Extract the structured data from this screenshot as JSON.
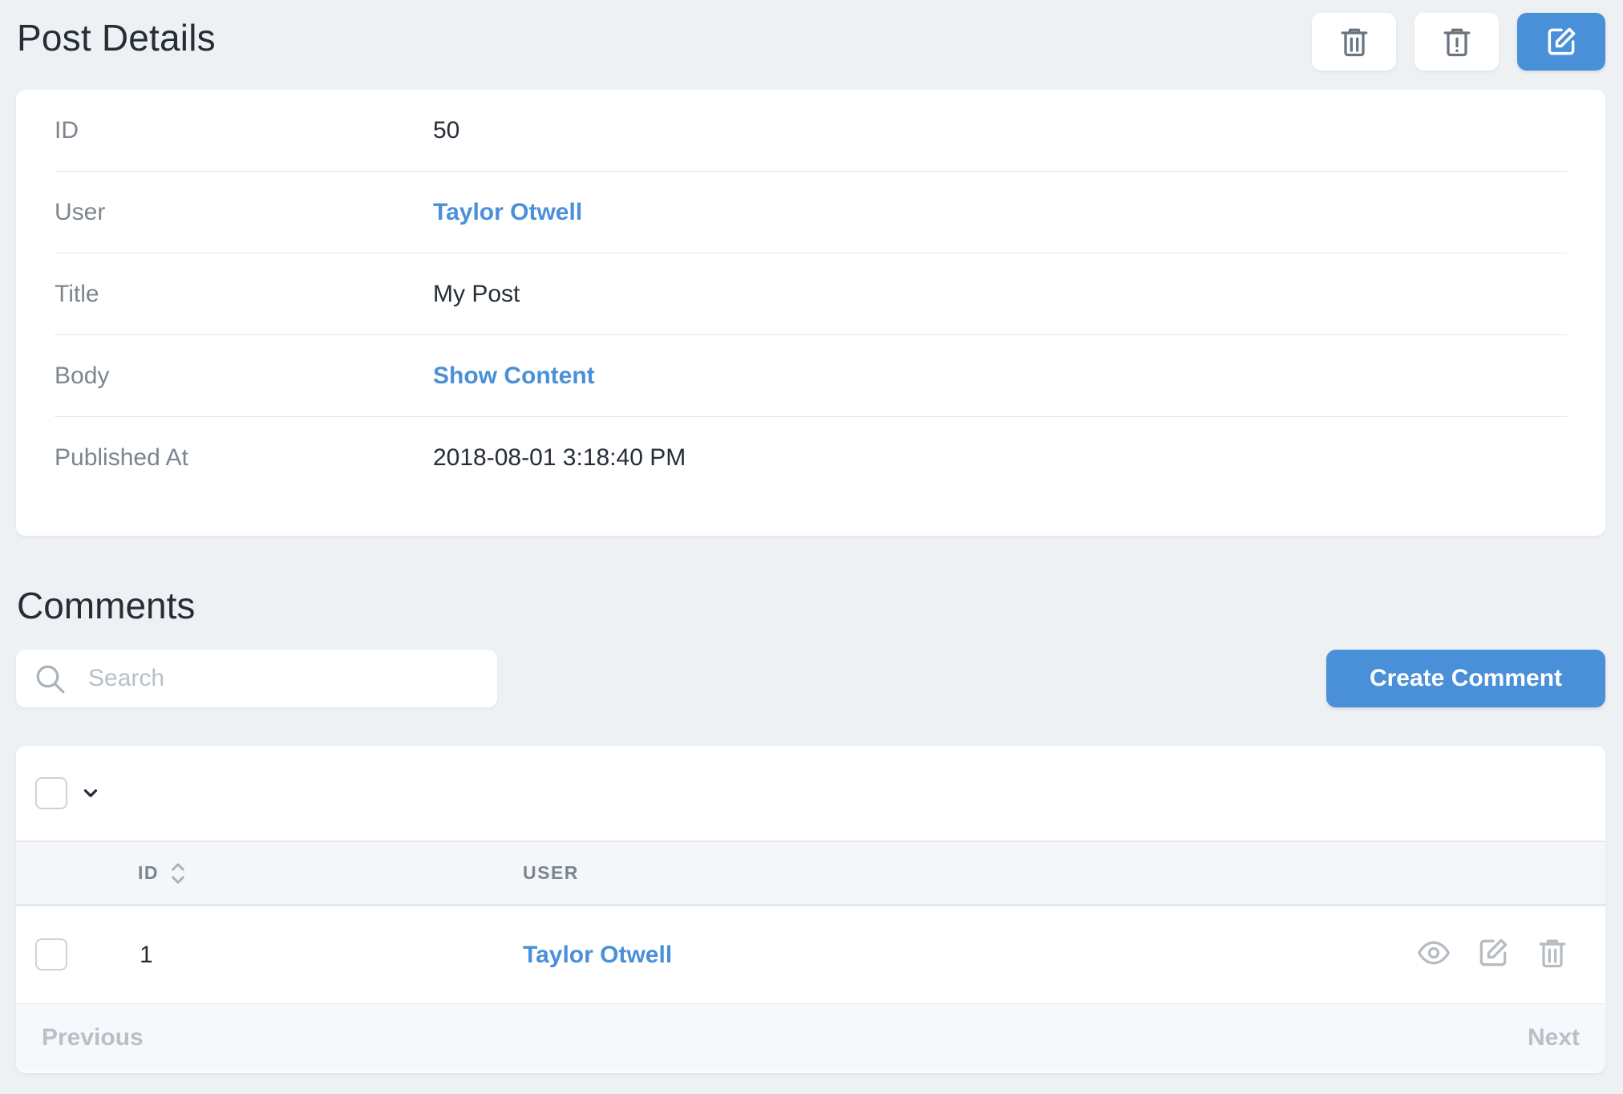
{
  "header": {
    "title": "Post Details"
  },
  "details": [
    {
      "label": "ID",
      "value": "50",
      "is_link": false
    },
    {
      "label": "User",
      "value": "Taylor Otwell",
      "is_link": true
    },
    {
      "label": "Title",
      "value": "My Post",
      "is_link": false
    },
    {
      "label": "Body",
      "value": "Show Content",
      "is_link": true
    },
    {
      "label": "Published At",
      "value": "2018-08-01 3:18:40 PM",
      "is_link": false
    }
  ],
  "comments": {
    "title": "Comments",
    "search_placeholder": "Search",
    "create_label": "Create Comment",
    "columns": {
      "id": "ID",
      "user": "USER"
    },
    "rows": [
      {
        "id": "1",
        "user": "Taylor Otwell"
      }
    ],
    "pagination": {
      "previous": "Previous",
      "next": "Next"
    }
  },
  "icons": {
    "header_actions": [
      "trash-icon",
      "force-delete-icon",
      "edit-icon"
    ],
    "row_actions": [
      "eye-icon",
      "edit-icon",
      "trash-icon"
    ],
    "search": "search-icon",
    "bulk_menu": "chevron-down-icon",
    "sort": "sort-icon"
  },
  "colors": {
    "accent": "#4a90d9",
    "background": "#eef1f4",
    "muted_text": "#7c858e",
    "icon_gray": "#b5bcc4"
  }
}
